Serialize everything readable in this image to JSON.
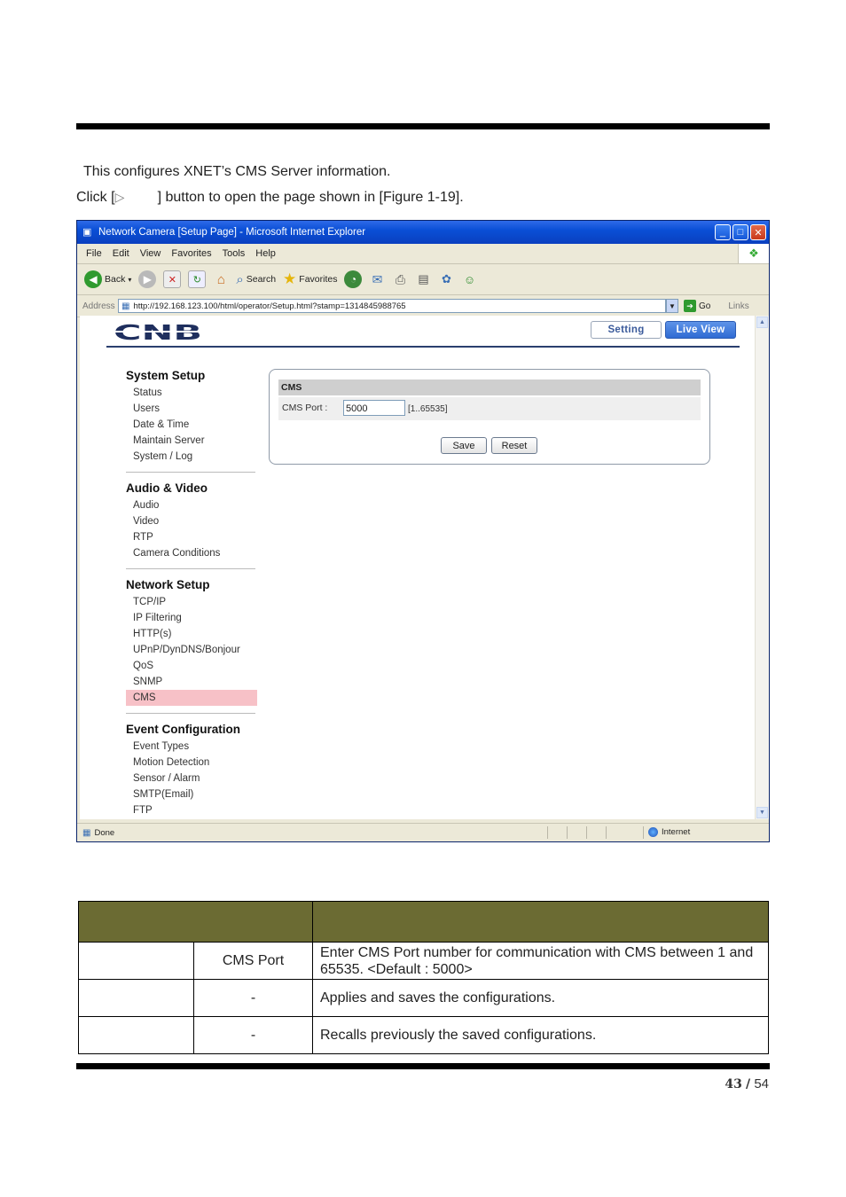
{
  "intro": {
    "line1": "This configures XNET’s CMS Server information.",
    "line2_prefix": "Click [",
    "line2_arrow": "▷",
    "line2_suffix": "] button to open the page shown in [Figure 1-19]."
  },
  "browser": {
    "title": "Network Camera [Setup Page] - Microsoft Internet Explorer",
    "menu": [
      "File",
      "Edit",
      "View",
      "Favorites",
      "Tools",
      "Help"
    ],
    "toolbar": {
      "back": "Back",
      "search": "Search",
      "favorites": "Favorites"
    },
    "address_label": "Address",
    "url": "http://192.168.123.100/html/operator/Setup.html?stamp=1314845988765",
    "go": "Go",
    "links": "Links",
    "status_left": "Done",
    "status_zone": "Internet"
  },
  "app": {
    "logo": "CNB",
    "setting_tab": "Setting",
    "live_view_tab": "Live View",
    "nav": [
      {
        "title": "System Setup",
        "items": [
          "Status",
          "Users",
          "Date & Time",
          "Maintain Server",
          "System / Log"
        ]
      },
      {
        "title": "Audio & Video",
        "items": [
          "Audio",
          "Video",
          "RTP",
          "Camera Conditions"
        ]
      },
      {
        "title": "Network Setup",
        "items": [
          "TCP/IP",
          "IP Filtering",
          "HTTP(s)",
          "UPnP/DynDNS/Bonjour",
          "QoS",
          "SNMP",
          "CMS"
        ]
      },
      {
        "title": "Event Configuration",
        "items": [
          "Event Types",
          "Motion Detection",
          "Sensor / Alarm",
          "SMTP(Email)",
          "FTP"
        ]
      }
    ],
    "active_item": "CMS",
    "cms": {
      "header": "CMS",
      "port_label": "CMS Port :",
      "port_value": "5000",
      "port_range": "[1..65535]",
      "save": "Save",
      "reset": "Reset"
    }
  },
  "table": {
    "rows": [
      {
        "col1": "",
        "col2": "CMS Port",
        "col3": "Enter CMS Port number for communication with CMS between 1 and 65535. <Default : 5000>"
      },
      {
        "col1": "",
        "col2": "-",
        "col3": "Applies and saves the configurations."
      },
      {
        "col1": "",
        "col2": "-",
        "col3": "Recalls previously the saved configurations."
      }
    ]
  },
  "page_number": {
    "current": "43",
    "sep": "/",
    "total": "54"
  },
  "colors": {
    "table_header": "#6b6b33",
    "active_nav": "#f7c1c7",
    "title_bar": "#0a4fd6"
  }
}
